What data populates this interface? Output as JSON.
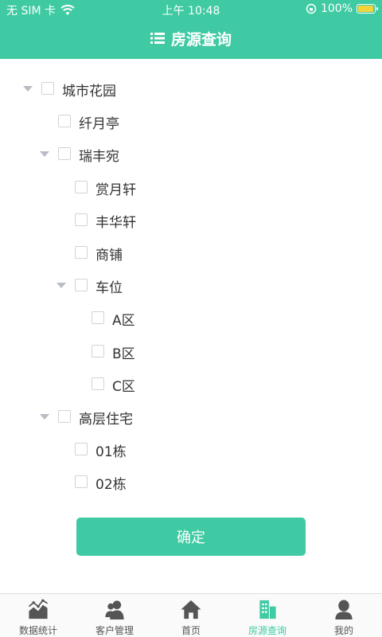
{
  "status": {
    "carrier": "无 SIM 卡",
    "time": "上午 10:48",
    "battery": "100%"
  },
  "header": {
    "title": "房源查询"
  },
  "tree": [
    {
      "label": "城市花园",
      "level": 0,
      "expanded": true
    },
    {
      "label": "纤月亭",
      "level": 1,
      "expanded": false,
      "leaf": true
    },
    {
      "label": "瑞丰宛",
      "level": 1,
      "expanded": true
    },
    {
      "label": "赏月轩",
      "level": 2,
      "leaf": true
    },
    {
      "label": "丰华轩",
      "level": 2,
      "leaf": true
    },
    {
      "label": "商铺",
      "level": 2,
      "leaf": true
    },
    {
      "label": "车位",
      "level": 2,
      "expanded": true
    },
    {
      "label": "A区",
      "level": 3,
      "leaf": true
    },
    {
      "label": "B区",
      "level": 3,
      "leaf": true
    },
    {
      "label": "C区",
      "level": 3,
      "leaf": true
    },
    {
      "label": "高层住宅",
      "level": 1,
      "expanded": true
    },
    {
      "label": "01栋",
      "level": 2,
      "leaf": true
    },
    {
      "label": "02栋",
      "level": 2,
      "leaf": true
    }
  ],
  "confirm_label": "确定",
  "tabs": [
    {
      "label": "数据统计",
      "icon": "chart-icon",
      "active": false
    },
    {
      "label": "客户管理",
      "icon": "customer-icon",
      "active": false
    },
    {
      "label": "首页",
      "icon": "home-icon",
      "active": false
    },
    {
      "label": "房源查询",
      "icon": "building-icon",
      "active": true
    },
    {
      "label": "我的",
      "icon": "profile-icon",
      "active": false
    }
  ],
  "colors": {
    "accent": "#3fcaa3",
    "arrow": "#b8bcc4",
    "checkbox_border": "#cfd3d8"
  }
}
